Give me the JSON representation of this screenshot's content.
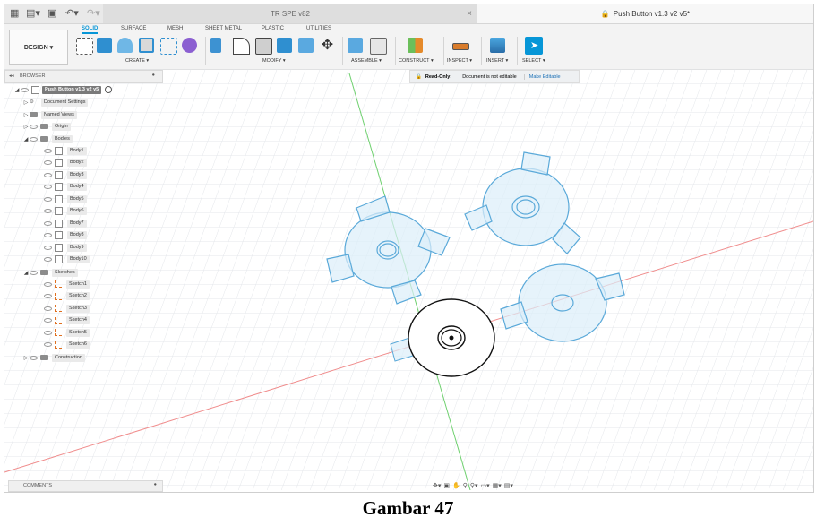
{
  "titlebar": {
    "inactive_tab_title": "TR SPE v82",
    "active_tab_title": "Push Button v1.3 v2 v5*",
    "close_glyph": "×"
  },
  "toolbar": {
    "design_label": "DESIGN ▾",
    "workspace_tabs": [
      "SOLID",
      "SURFACE",
      "MESH",
      "SHEET METAL",
      "PLASTIC",
      "UTILITIES"
    ],
    "active_workspace": "SOLID",
    "groups": [
      "CREATE ▾",
      "MODIFY ▾",
      "ASSEMBLE ▾",
      "CONSTRUCT ▾",
      "INSPECT ▾",
      "INSERT ▾",
      "SELECT ▾"
    ]
  },
  "browser": {
    "header": "BROWSER",
    "root": "Push Button v1.3 v2 v5",
    "document_settings": "Document Settings",
    "named_views": "Named Views",
    "origin": "Origin",
    "bodies_folder": "Bodies",
    "bodies": [
      "Body1",
      "Body2",
      "Body3",
      "Body4",
      "Body5",
      "Body6",
      "Body7",
      "Body8",
      "Body9",
      "Body10"
    ],
    "sketches_folder": "Sketches",
    "sketches": [
      "Sketch1",
      "Sketch2",
      "Sketch3",
      "Sketch4",
      "Sketch5",
      "Sketch6"
    ],
    "construction": "Construction"
  },
  "readonly": {
    "label": "Read-Only:",
    "message": "Document is not editable",
    "action": "Make Editable"
  },
  "comments": {
    "label": "COMMENTS"
  },
  "caption": "Gambar 47",
  "colors": {
    "accent": "#0696d7",
    "sketch_fill": "#dceefa",
    "sketch_stroke": "#5aa9d9"
  }
}
